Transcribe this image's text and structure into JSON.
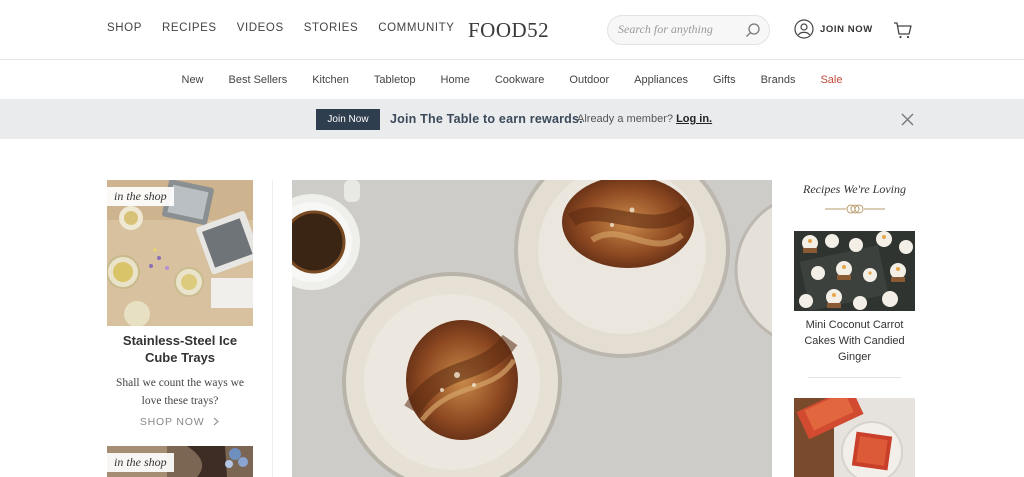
{
  "header": {
    "nav": [
      "SHOP",
      "RECIPES",
      "VIDEOS",
      "STORIES",
      "COMMUNITY"
    ],
    "logo": "FOOD52",
    "search_placeholder": "Search for anything",
    "join_label": "JOIN NOW"
  },
  "subnav": {
    "items": [
      "New",
      "Best Sellers",
      "Kitchen",
      "Tabletop",
      "Home",
      "Cookware",
      "Outdoor",
      "Appliances",
      "Gifts",
      "Brands"
    ],
    "sale": "Sale",
    "sale_color": "#c44d3d"
  },
  "promo": {
    "button": "Join Now",
    "message": "Join The Table to earn rewards.",
    "member_text": "Already a member?",
    "login": "Log in.",
    "accent": "#2f3e4e"
  },
  "left_card": {
    "badge": "in the shop",
    "title": "Stainless-Steel Ice Cube Trays",
    "description": "Shall we count the ways we love these trays?",
    "cta": "SHOP NOW",
    "badge2": "in the shop"
  },
  "right_col": {
    "title": "Recipes We're Loving",
    "recipe1": "Mini Coconut Carrot Cakes With Candied Ginger"
  },
  "icons": [
    "search-icon",
    "user-icon",
    "cart-icon",
    "close-icon",
    "chevron-right-icon"
  ]
}
